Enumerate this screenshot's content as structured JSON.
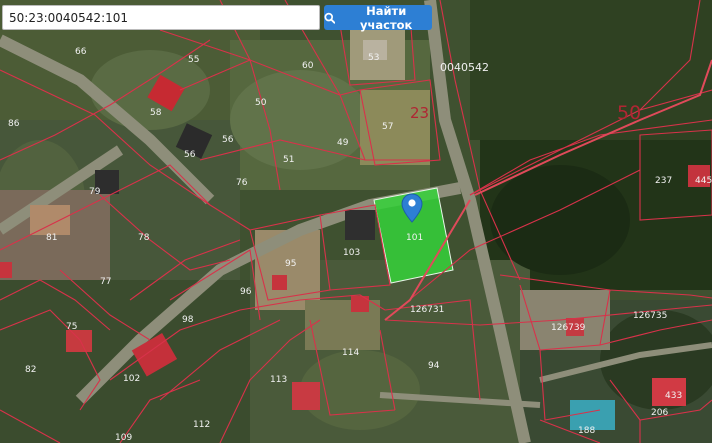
{
  "search": {
    "value": "50:23:0040542:101",
    "button_label": "Найти участок"
  },
  "map": {
    "block_labels": {
      "quarter": "0040542",
      "block_23": "23",
      "block_50": "50"
    },
    "parcel_labels": {
      "p53": "53",
      "p66": "66",
      "p55": "55",
      "p60": "60",
      "p86": "86",
      "p58": "58",
      "p50": "50",
      "p57": "57",
      "p56a": "56",
      "p56b": "56",
      "p49": "49",
      "p51": "51",
      "p79": "79",
      "p76": "76",
      "p103": "103",
      "p101": "101",
      "p81": "81",
      "p78": "78",
      "p95": "95",
      "p77": "77",
      "p96": "96",
      "p98": "98",
      "p75": "75",
      "p114": "114",
      "p94": "94",
      "p82": "82",
      "p102": "102",
      "p113": "113",
      "p112": "112",
      "p109": "109",
      "p237": "237",
      "p126731": "126731",
      "p126739": "126739",
      "p126735": "126735",
      "p206": "206",
      "p188": "188",
      "p433": "433",
      "p445": "445"
    },
    "colors": {
      "boundary": "#d8324a",
      "selected_fill": "#35d23a",
      "marker": "#2d7fd4"
    }
  }
}
